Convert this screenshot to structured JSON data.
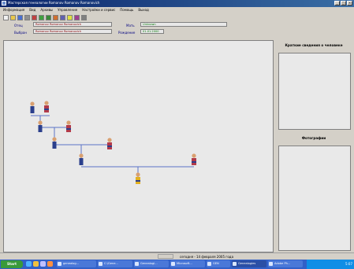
{
  "window": {
    "title": "Мастерская генеалогии Romanov Romanov Romanovich",
    "controls": [
      "_",
      "□",
      "×"
    ]
  },
  "menu": [
    "Информация",
    "Вид",
    "Архивы",
    "Управление",
    "Настройки и сервис",
    "Помощь",
    "Выход"
  ],
  "toolbar": {
    "icons": [
      "new-icon",
      "open-icon",
      "save-icon",
      "print-icon",
      "person-icon",
      "search-icon",
      "tree-icon",
      "photo-icon",
      "settings-icon",
      "help-icon",
      "chart-icon",
      "exit-icon"
    ]
  },
  "info": {
    "row1": {
      "label1": "Отец",
      "value1": "Romanov Romanov Romanovich",
      "label2": "Мать",
      "value2": "Unknown"
    },
    "row2": {
      "label1": "Выбран",
      "value1": "Romanov Romanov Romanovich",
      "label2": "Рождение",
      "value2": "01.01.2000"
    }
  },
  "side": {
    "summary_title": "Краткие сведения о человеке",
    "photos_title": "Фотографии"
  },
  "status": {
    "text": "сегодня - 14 февраля 2005 года"
  },
  "taskbar": {
    "start": "Start",
    "tasks": [
      "genealog...",
      "C:\\Gene...",
      "Genealogi...",
      "Microsoft...",
      "GEN",
      "Genealogies",
      "Adobe Ph..."
    ],
    "clock": "5:07"
  },
  "colors": {
    "line": "#5b74c6",
    "titlebar": "#0a246a",
    "panel": "#e9e9e9"
  }
}
